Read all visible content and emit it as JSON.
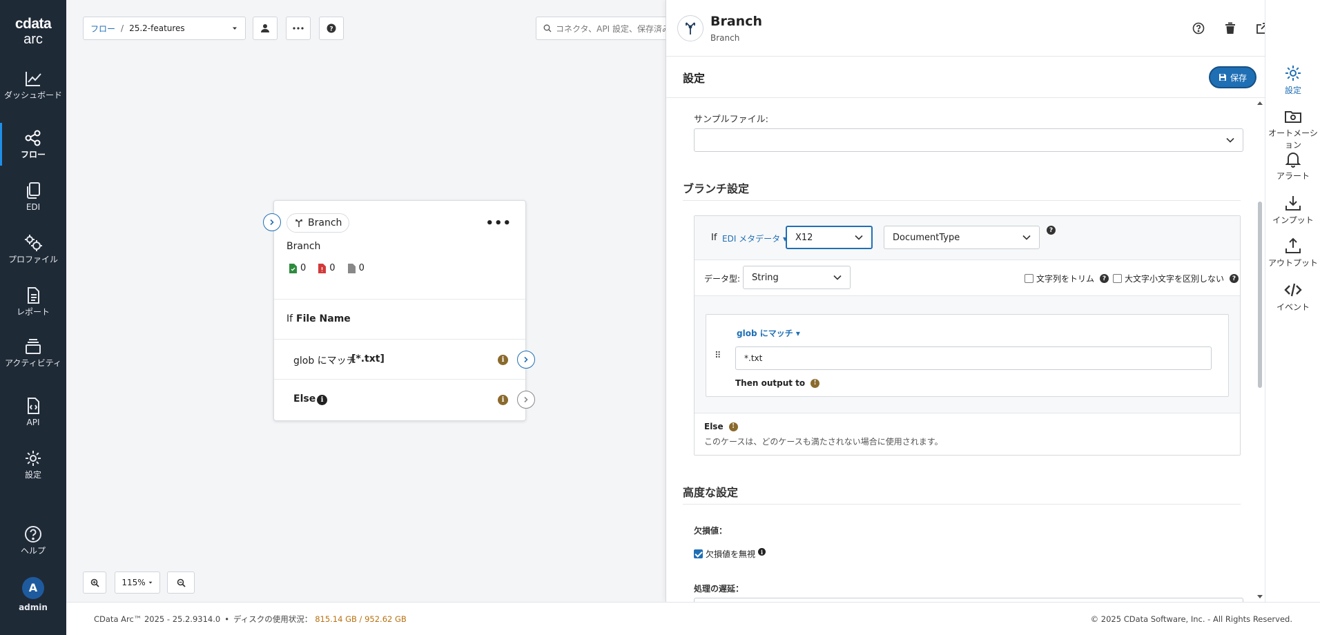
{
  "nav": {
    "logo_top": "cdata",
    "logo_bottom": "arc",
    "items": [
      {
        "label": "ダッシュボード",
        "icon": "chart-line-icon"
      },
      {
        "label": "フロー",
        "icon": "flow-icon"
      },
      {
        "label": "EDI",
        "icon": "documents-icon"
      },
      {
        "label": "プロファイル",
        "icon": "gears-icon"
      },
      {
        "label": "レポート",
        "icon": "report-icon"
      },
      {
        "label": "アクティビティ",
        "icon": "stack-icon"
      },
      {
        "label": "API",
        "icon": "api-icon"
      },
      {
        "label": "設定",
        "icon": "gear-icon"
      },
      {
        "label": "ヘルプ",
        "icon": "help-icon"
      }
    ],
    "user": {
      "initial": "A",
      "name": "admin"
    }
  },
  "toolbar": {
    "crumb_root": "フロー",
    "crumb_sep": "/",
    "crumb_current": "25.2-features",
    "search_placeholder": "コネクタ、API 設定、保存済み"
  },
  "node": {
    "badge": "Branch",
    "title": "Branch",
    "counts": {
      "success": "0",
      "error": "0",
      "pending": "0"
    },
    "if_prefix": "If",
    "if_field": "File Name",
    "case_label": "glob にマッチ",
    "case_value": "[*.txt]",
    "else_label": "Else"
  },
  "zoom": {
    "level": "115%"
  },
  "footer": {
    "version": "CData Arc™ 2025 - 25.2.9314.0",
    "bullet": "•",
    "disk_label": "ディスクの使用状況：",
    "disk_value": "815.14 GB / 952.62 GB",
    "copyright": "© 2025 CData Software, Inc. - All Rights Reserved."
  },
  "panel": {
    "title": "Branch",
    "subtitle": "Branch",
    "settings_title": "設定",
    "save_label": "保存",
    "sample_file_label": "サンプルファイル:",
    "sample_file_value": "",
    "branch_section": "ブランチ設定",
    "if_label": "If",
    "source_link": "EDI メタデータ",
    "standard_value": "X12",
    "field_value": "DocumentType",
    "datatype_label": "データ型:",
    "datatype_value": "String",
    "trim_label": "文字列をトリム",
    "case_insensitive_label": "大文字小文字を区別しない",
    "match_link": "glob にマッチ",
    "match_value": "*.txt",
    "then_output": "Then output to",
    "else_title": "Else",
    "else_desc": "このケースは、どのケースも満たされない場合に使用されます。",
    "advanced_section": "高度な設定",
    "missing_label": "欠損値：",
    "ignore_missing_label": "欠損値を無視",
    "ignore_missing_checked": true,
    "delay_label": "処理の遅延："
  },
  "rail": {
    "items": [
      {
        "label": "設定",
        "icon": "gear-icon"
      },
      {
        "label": "オートメーション",
        "icon": "automation-icon"
      },
      {
        "label": "アラート",
        "icon": "bell-icon"
      },
      {
        "label": "インプット",
        "icon": "download-icon"
      },
      {
        "label": "アウトプット",
        "icon": "upload-icon"
      },
      {
        "label": "イベント",
        "icon": "code-icon"
      }
    ]
  },
  "colors": {
    "nav_bg": "#1f2a37",
    "accent": "#1f6fb5",
    "disk_text": "#b8700f",
    "success": "#2e8b3e",
    "error": "#d23a3a"
  }
}
